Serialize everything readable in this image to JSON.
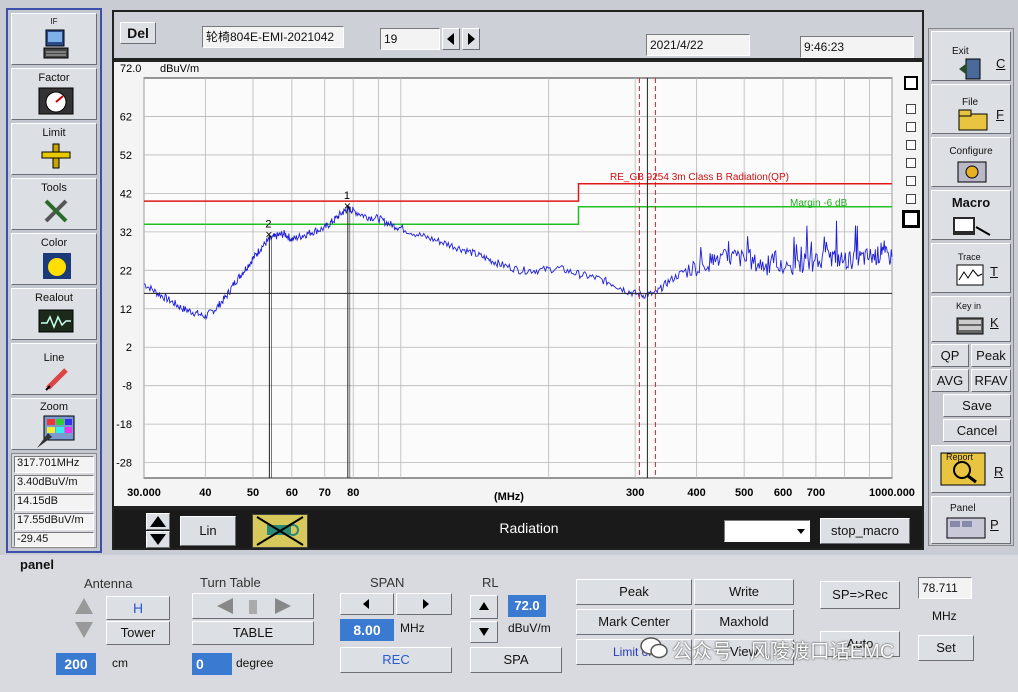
{
  "toolbar": {
    "del_label": "Del",
    "filename": "轮椅804E-EMI-2021042",
    "trace_number": "19",
    "date": "2021/4/22",
    "time": "9:46:23"
  },
  "left_sidebar": {
    "items": [
      {
        "label": "IF"
      },
      {
        "label": "Factor"
      },
      {
        "label": "Limit"
      },
      {
        "label": "Tools"
      },
      {
        "label": "Color"
      },
      {
        "label": "Realout"
      },
      {
        "label": "Line"
      },
      {
        "label": "Zoom"
      }
    ],
    "readouts": [
      "317.701MHz",
      "3.40dBuV/m",
      "14.15dB",
      "17.55dBuV/m",
      "-29.45"
    ]
  },
  "right_sidebar": {
    "exit": {
      "label": "Exit",
      "key": "C"
    },
    "file": {
      "label": "File",
      "key": "F"
    },
    "configure": {
      "label": "Configure"
    },
    "macro": {
      "label": "Macro"
    },
    "trace": {
      "label": "Trace",
      "key": "T"
    },
    "keyin": {
      "label": "Key in",
      "key": "K"
    },
    "qp": "QP",
    "peak": "Peak",
    "avg": "AVG",
    "rfav": "RFAV",
    "save": "Save",
    "cancel": "Cancel",
    "report": {
      "label": "Report",
      "key": "R"
    },
    "panel": {
      "label": "Panel",
      "key": "P"
    }
  },
  "chart_data": {
    "type": "line",
    "ylabel_top": "72.0",
    "yunit": "dBuV/m",
    "xunit": "(MHz)",
    "ylim": [
      -32,
      72
    ],
    "xlim": [
      30,
      1000
    ],
    "x_scale": "log",
    "y_ticks": [
      62,
      52,
      42,
      32,
      22,
      12,
      2,
      -8,
      -18,
      -28
    ],
    "x_ticks": [
      "30.000",
      "40",
      "50",
      "60",
      "70",
      "80",
      "300",
      "400",
      "500",
      "600",
      "700",
      "1000.000"
    ],
    "x_tick_values": [
      30,
      40,
      50,
      60,
      70,
      80,
      300,
      400,
      500,
      600,
      700,
      1000
    ],
    "limit_label": "RE_GB 9254 3m Class B Radiation(QP)",
    "margin_label": "Margin -6 dB",
    "limit_line": [
      [
        30,
        40
      ],
      [
        230,
        40
      ],
      [
        230,
        44.5
      ],
      [
        1000,
        44.5
      ]
    ],
    "margin_line": [
      [
        30,
        34
      ],
      [
        230,
        34
      ],
      [
        230,
        38.5
      ],
      [
        1000,
        38.5
      ]
    ],
    "markers": [
      {
        "label": "1",
        "x": 78,
        "y": 38.5
      },
      {
        "label": "2",
        "x": 54,
        "y": 31
      }
    ],
    "cursor_x_mhz": 317.701,
    "trace": [
      [
        30,
        18.5
      ],
      [
        32,
        16
      ],
      [
        34,
        14
      ],
      [
        36,
        12
      ],
      [
        38,
        11
      ],
      [
        40,
        10
      ],
      [
        42,
        12
      ],
      [
        44,
        15
      ],
      [
        46,
        19
      ],
      [
        48,
        22
      ],
      [
        50,
        25
      ],
      [
        52,
        28
      ],
      [
        54,
        30
      ],
      [
        56,
        31
      ],
      [
        58,
        31.5
      ],
      [
        60,
        30
      ],
      [
        63,
        31
      ],
      [
        66,
        32
      ],
      [
        70,
        33
      ],
      [
        73,
        35
      ],
      [
        76,
        37
      ],
      [
        78,
        38
      ],
      [
        80,
        37.5
      ],
      [
        85,
        36
      ],
      [
        90,
        35.5
      ],
      [
        95,
        34
      ],
      [
        100,
        33
      ],
      [
        110,
        31
      ],
      [
        120,
        29.5
      ],
      [
        130,
        28
      ],
      [
        140,
        26.5
      ],
      [
        150,
        25
      ],
      [
        160,
        23.5
      ],
      [
        175,
        22
      ],
      [
        190,
        22
      ],
      [
        210,
        22.5
      ],
      [
        230,
        21
      ],
      [
        250,
        20
      ],
      [
        270,
        18.5
      ],
      [
        290,
        16.5
      ],
      [
        310,
        15.5
      ],
      [
        330,
        16
      ],
      [
        350,
        19
      ],
      [
        380,
        22
      ],
      [
        420,
        24
      ],
      [
        450,
        25
      ],
      [
        480,
        25.5
      ],
      [
        520,
        24
      ],
      [
        560,
        23
      ],
      [
        600,
        22.5
      ],
      [
        650,
        23
      ],
      [
        700,
        24
      ],
      [
        750,
        25.5
      ],
      [
        800,
        24.5
      ],
      [
        850,
        25
      ],
      [
        900,
        25.5
      ],
      [
        950,
        26
      ],
      [
        1000,
        25.5
      ]
    ],
    "grid": true
  },
  "bottom_strip": {
    "lin_label": "Lin",
    "mode_label": "Radiation",
    "stop_macro_label": "stop_macro"
  },
  "panel": {
    "title": "panel",
    "antenna": {
      "title": "Antenna",
      "polarization": "H",
      "tower_label": "Tower",
      "height_value": "200",
      "height_unit": "cm"
    },
    "turntable": {
      "title": "Turn Table",
      "table_label": "TABLE",
      "angle_value": "0",
      "angle_unit": "degree"
    },
    "span": {
      "title": "SPAN",
      "value": "8.00",
      "unit": "MHz",
      "rec_label": "REC"
    },
    "rl": {
      "title": "RL",
      "value": "72.0",
      "unit": "dBuV/m",
      "spa_label": "SPA"
    },
    "buttons": {
      "peak": "Peak",
      "write": "Write",
      "mark_center": "Mark Center",
      "maxhold": "Maxhold",
      "limit_on": "Limit on",
      "view": "View",
      "auto": "Auto",
      "sp_rec": "SP=>Rec",
      "set": "Set"
    },
    "freq_value": "78.711",
    "freq_unit": "MHz"
  },
  "watermark": "公众号 · 风陵渡口话EMC"
}
